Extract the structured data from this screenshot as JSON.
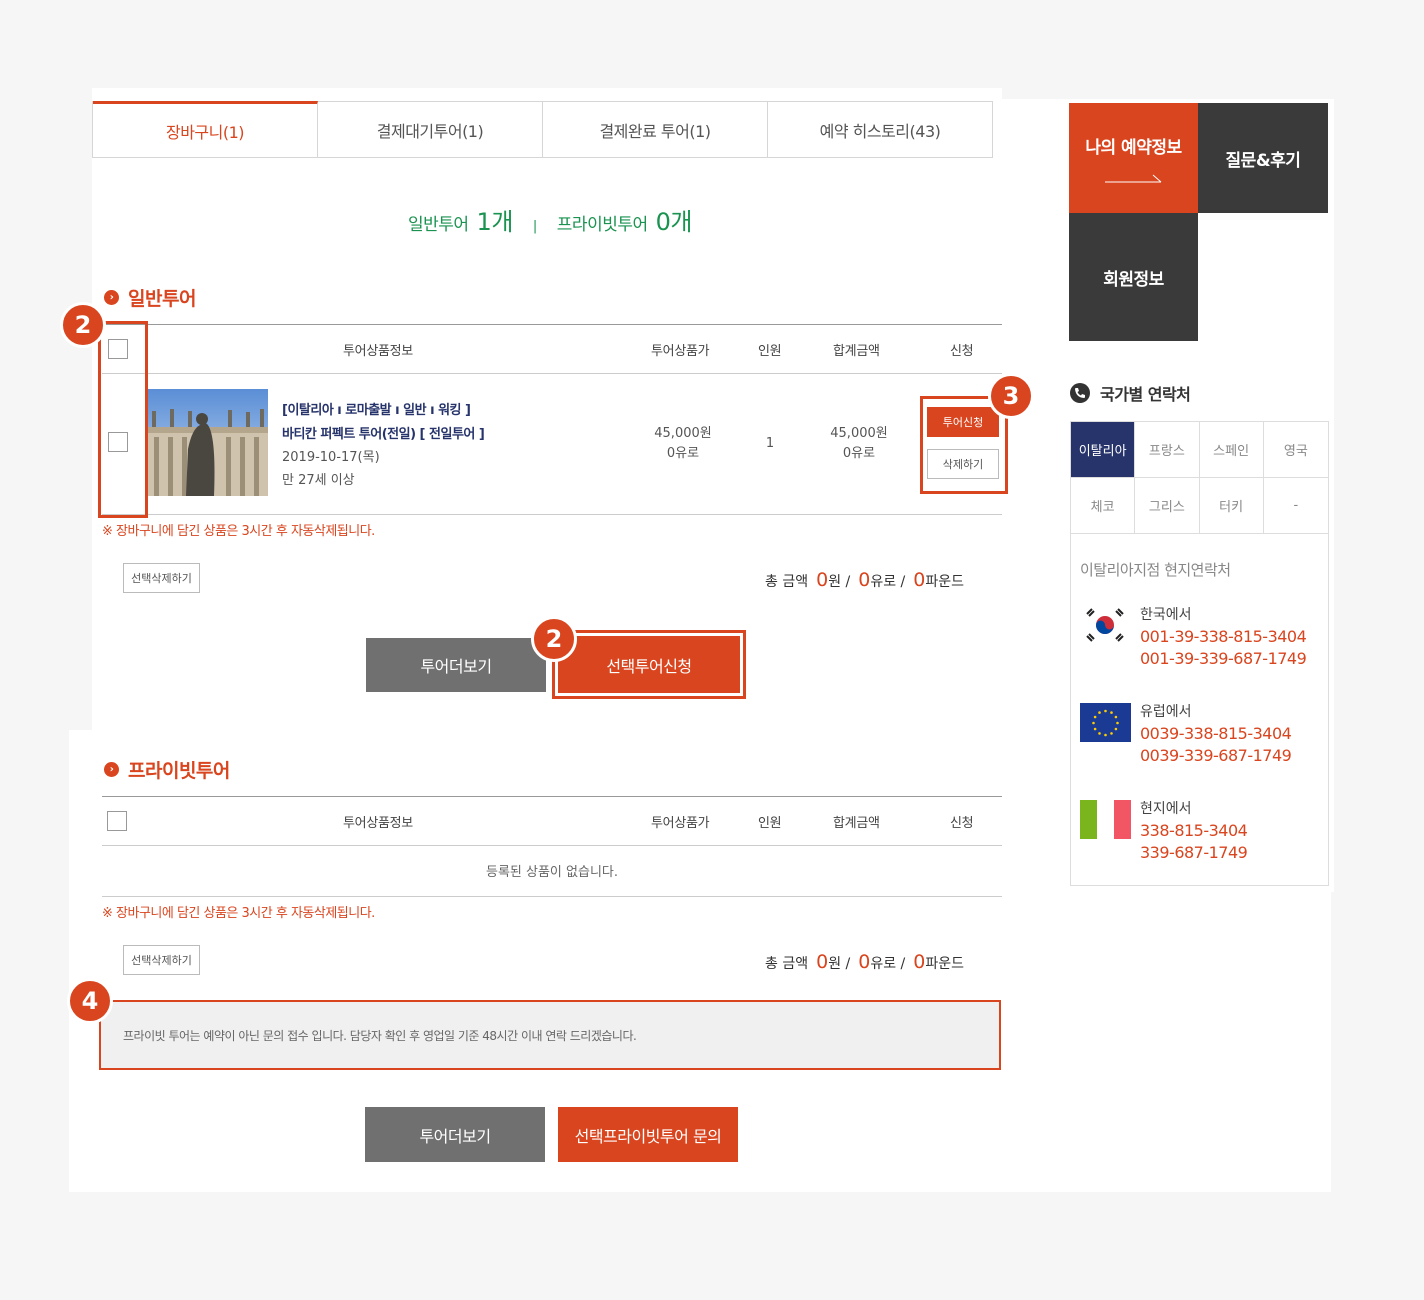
{
  "tabs": [
    {
      "label": "장바구니(1)",
      "active": true
    },
    {
      "label": "결제대기투어(1)",
      "active": false
    },
    {
      "label": "결제완료 투어(1)",
      "active": false
    },
    {
      "label": "예약 히스토리(43)",
      "active": false
    }
  ],
  "summary": {
    "general_label": "일반투어",
    "general_count": "1개",
    "separator": "|",
    "private_label": "프라이빗투어",
    "private_count": "0개"
  },
  "general": {
    "title": "일반투어",
    "headers": {
      "info": "투어상품정보",
      "price": "투어상품가",
      "people": "인원",
      "total": "합계금액",
      "apply": "신청"
    },
    "item": {
      "tags": "[이탈리아 ı 로마출발 ı 일반 ı 워킹 ]",
      "name": "바티칸 퍼펙트 투어(전일) [ 전일투어 ]",
      "date": "2019-10-17(목)",
      "age": "만 27세 이상",
      "price_won": "45,000원",
      "price_eur": "0유로",
      "people": "1",
      "total_won": "45,000원",
      "total_eur": "0유로",
      "apply_button": "투어신청",
      "delete_button": "삭제하기"
    },
    "note": "※ 장바구니에 담긴 상품은 3시간 후 자동삭제됩니다.",
    "delete_selected": "선택삭제하기",
    "total": {
      "label": "총 금액",
      "won": "0",
      "won_unit": "원 /",
      "eur": "0",
      "eur_unit": "유로 /",
      "gbp": "0",
      "gbp_unit": "파운드"
    },
    "more_button": "투어더보기",
    "apply_selected_button": "선택투어신청"
  },
  "private": {
    "title": "프라이빗투어",
    "headers": {
      "info": "투어상품정보",
      "price": "투어상품가",
      "people": "인원",
      "total": "합계금액",
      "apply": "신청"
    },
    "empty": "등록된 상품이 없습니다.",
    "note": "※ 장바구니에 담긴 상품은 3시간 후 자동삭제됩니다.",
    "delete_selected": "선택삭제하기",
    "total": {
      "label": "총 금액",
      "won": "0",
      "won_unit": "원 /",
      "eur": "0",
      "eur_unit": "유로 /",
      "gbp": "0",
      "gbp_unit": "파운드"
    },
    "info_text": "프라이빗 투어는 예약이 아닌 문의 접수 입니다. 담당자 확인 후 영업일 기준 48시간 이내 연락 드리겠습니다.",
    "more_button": "투어더보기",
    "inquiry_button": "선택프라이빗투어 문의"
  },
  "markers": {
    "m1": "2",
    "m2": "2",
    "m3": "3",
    "m4": "4"
  },
  "sidebar": {
    "my_reservation": "나의 예약정보",
    "qna": "질문&후기",
    "member": "회원정보",
    "contact_title": "국가별 연락처",
    "countries": [
      "이탈리아",
      "프랑스",
      "스페인",
      "영국",
      "체코",
      "그리스",
      "터키",
      "-"
    ],
    "branch_title": "이탈리아지점 현지연락처",
    "contacts": [
      {
        "label": "한국에서",
        "phone1": "001-39-338-815-3404",
        "phone2": "001-39-339-687-1749",
        "flag": "korea-flag"
      },
      {
        "label": "유럽에서",
        "phone1": "0039-338-815-3404",
        "phone2": "0039-339-687-1749",
        "flag": "eu-flag"
      },
      {
        "label": "현지에서",
        "phone1": "338-815-3404",
        "phone2": "339-687-1749",
        "flag": "italy-flag"
      }
    ]
  },
  "colors": {
    "accent": "#d9451e",
    "dark": "#3a3a3a",
    "green": "#1a9350",
    "navy": "#27346b"
  }
}
